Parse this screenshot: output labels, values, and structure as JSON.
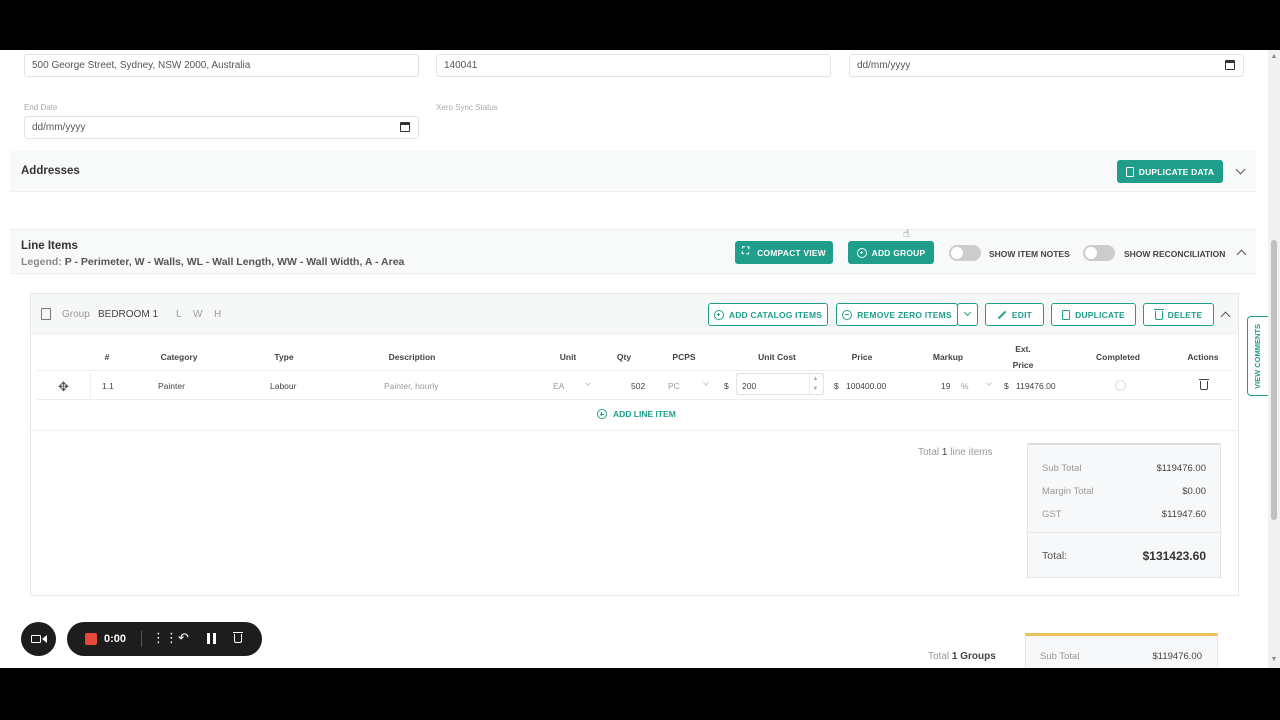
{
  "form": {
    "address_value": "500 George Street, Sydney, NSW 2000, Australia",
    "number_value": "140041",
    "start_date_placeholder": "dd/mm/yyyy",
    "end_date_label": "End Date",
    "end_date_placeholder": "dd/mm/yyyy",
    "xero_sync_label": "Xero Sync Status"
  },
  "addresses": {
    "title": "Addresses",
    "duplicate_label": "DUPLICATE DATA"
  },
  "line_items": {
    "title": "Line Items",
    "legend_label": "Legend:",
    "legend_text": "P - Perimeter, W - Walls, WL - Wall Length, WW - Wall Width, A - Area",
    "compact_view_label": "COMPACT VIEW",
    "add_group_label": "ADD GROUP",
    "show_item_notes_label": "SHOW ITEM NOTES",
    "show_reconciliation_label": "SHOW RECONCILIATION"
  },
  "group": {
    "label": "Group",
    "name": "BEDROOM 1",
    "dims": [
      "L",
      "W",
      "H"
    ],
    "add_catalog_label": "ADD CATALOG ITEMS",
    "remove_zero_label": "REMOVE ZERO ITEMS",
    "edit_label": "EDIT",
    "duplicate_label": "DUPLICATE",
    "delete_label": "DELETE",
    "columns": [
      "#",
      "Category",
      "Type",
      "Description",
      "Unit",
      "Qty",
      "PCPS",
      "Unit Cost",
      "Price",
      "Markup",
      "Ext.",
      "Price",
      "Completed",
      "Actions"
    ],
    "row": {
      "num": "1.1",
      "category": "Painter",
      "type": "Labour",
      "description": "Painter, hourly",
      "unit": "EA",
      "qty": "502",
      "pcps": "PC",
      "currency": "$",
      "unit_cost": "200",
      "price": "100400.00",
      "markup": "19",
      "markup_unit": "%",
      "ext_price": "119476.00"
    },
    "add_line_item_label": "ADD LINE ITEM",
    "total_prefix": "Total",
    "total_count": "1",
    "total_suffix": "line items"
  },
  "group_summary": {
    "sub_total_label": "Sub Total",
    "sub_total_value": "$119476.00",
    "margin_total_label": "Margin Total",
    "margin_total_value": "$0.00",
    "gst_label": "GST",
    "gst_value": "$11947.60",
    "total_label": "Total:",
    "total_value": "$131423.60"
  },
  "grand": {
    "total_prefix": "Total",
    "total_count": "1",
    "total_suffix": "Groups",
    "sub_total_label": "Sub Total",
    "sub_total_value": "$119476.00"
  },
  "recorder": {
    "time": "0:00"
  },
  "side_tab": {
    "label": "VIEW COMMENTS"
  },
  "colors": {
    "accent": "#1f9e8c",
    "summary_top_border": "#e8c25a"
  }
}
